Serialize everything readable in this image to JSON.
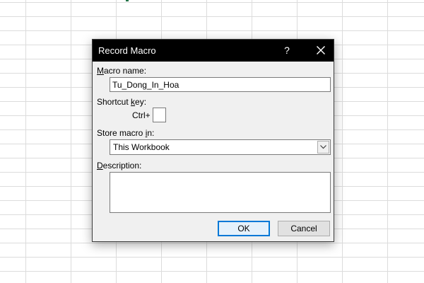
{
  "dialog": {
    "title": "Record Macro",
    "help_label": "?",
    "macro_name": {
      "label_accel": "M",
      "label_rest": "acro name:",
      "value": "Tu_Dong_In_Hoa"
    },
    "shortcut_key": {
      "label_start": "Shortcut ",
      "label_accel": "k",
      "label_end": "ey:",
      "ctrl_label": "Ctrl+",
      "value": ""
    },
    "store_macro_in": {
      "label_start": "Store macro ",
      "label_accel": "i",
      "label_end": "n:",
      "selected": "This Workbook"
    },
    "description": {
      "label_accel": "D",
      "label_rest": "escription:",
      "value": ""
    },
    "buttons": {
      "ok_label": "OK",
      "cancel_label": "Cancel"
    }
  },
  "icons": {
    "close": "close-icon",
    "dropdown": "chevron-down-icon"
  },
  "colors": {
    "titlebar": "#000000",
    "dialog_bg": "#f0f0f0",
    "focus_border": "#0078d7",
    "sheet_accent": "#217346"
  }
}
